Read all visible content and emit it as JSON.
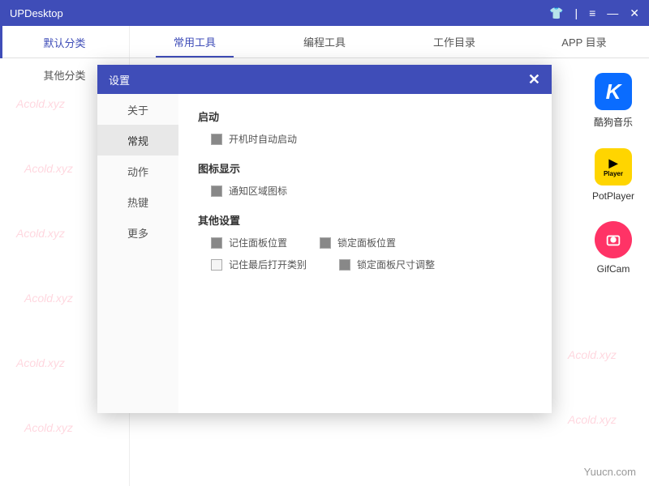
{
  "titlebar": {
    "title": "UPDesktop"
  },
  "sidebar": {
    "items": [
      {
        "label": "默认分类",
        "active": true
      },
      {
        "label": "其他分类",
        "active": false
      }
    ]
  },
  "tabs": [
    {
      "label": "常用工具",
      "active": true
    },
    {
      "label": "编程工具",
      "active": false
    },
    {
      "label": "工作目录",
      "active": false
    },
    {
      "label": "APP 目录",
      "active": false
    }
  ],
  "apps": [
    {
      "label": "酷狗音乐",
      "icon": "k"
    },
    {
      "label": "PotPlayer",
      "icon": "pot"
    },
    {
      "label": "GifCam",
      "icon": "gif"
    }
  ],
  "modal": {
    "title": "设置",
    "nav": [
      {
        "label": "关于",
        "active": false
      },
      {
        "label": "常规",
        "active": true
      },
      {
        "label": "动作",
        "active": false
      },
      {
        "label": "热键",
        "active": false
      },
      {
        "label": "更多",
        "active": false
      }
    ],
    "sections": [
      {
        "title": "启动",
        "rows": [
          [
            {
              "label": "开机时自动启动",
              "checked": true
            }
          ]
        ]
      },
      {
        "title": "图标显示",
        "rows": [
          [
            {
              "label": "通知区域图标",
              "checked": true
            }
          ]
        ]
      },
      {
        "title": "其他设置",
        "rows": [
          [
            {
              "label": "记住面板位置",
              "checked": true
            },
            {
              "label": "锁定面板位置",
              "checked": true
            }
          ],
          [
            {
              "label": "记住最后打开类别",
              "checked": false
            },
            {
              "label": "锁定面板尺寸调整",
              "checked": true
            }
          ]
        ]
      }
    ]
  },
  "watermark": "Acold.xyz",
  "footer": "Yuucn.com"
}
